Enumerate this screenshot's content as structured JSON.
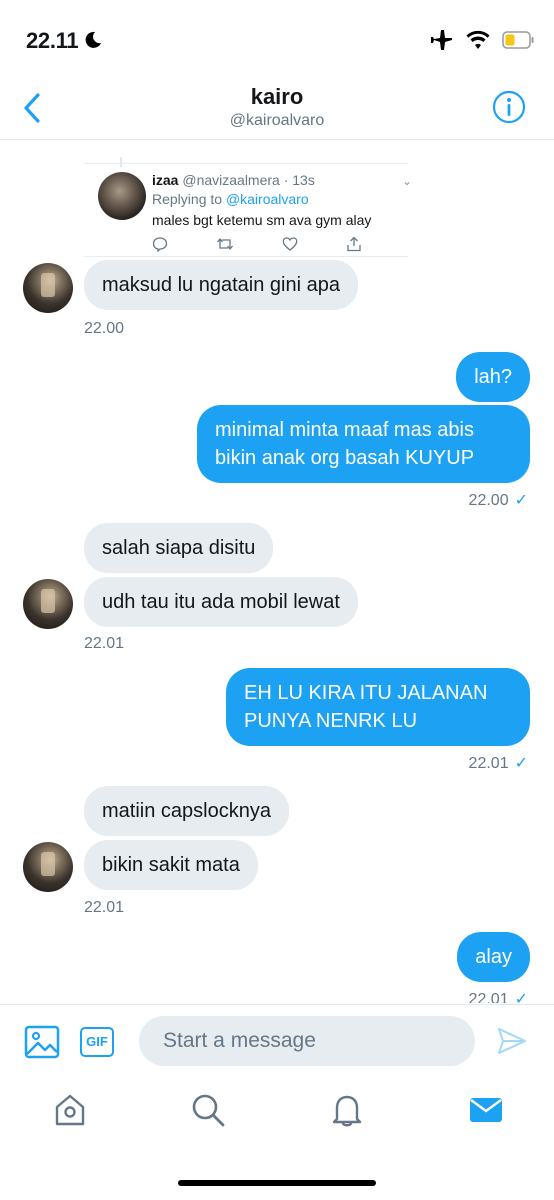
{
  "status_bar": {
    "time": "22.11"
  },
  "header": {
    "title": "kairo",
    "handle": "@kairoalvaro"
  },
  "quoted_tweet": {
    "name": "izaa",
    "meta": "@navizaalmera · 13s",
    "replying_label": "Replying to ",
    "replying_to": "@kairoalvaro",
    "text": "males bgt ketemu sm ava gym alay"
  },
  "messages": [
    {
      "id": "m1",
      "direction": "in",
      "text": "maksud lu ngatain gini apa"
    },
    {
      "id": "t1",
      "stamp": "22.00"
    },
    {
      "id": "m2",
      "direction": "out",
      "text": "lah?"
    },
    {
      "id": "m3",
      "direction": "out",
      "text": "minimal minta maaf mas abis bikin anak org basah KUYUP"
    },
    {
      "id": "t2",
      "stamp": "22.00",
      "check": "✓"
    },
    {
      "id": "m4",
      "direction": "in",
      "text": "salah siapa disitu"
    },
    {
      "id": "m5",
      "direction": "in",
      "text": "udh tau itu ada mobil lewat"
    },
    {
      "id": "t3",
      "stamp": "22.01"
    },
    {
      "id": "m6",
      "direction": "out",
      "text": "EH LU KIRA ITU JALANAN PUNYA NENRK LU"
    },
    {
      "id": "t4",
      "stamp": "22.01",
      "check": "✓"
    },
    {
      "id": "m7",
      "direction": "in",
      "text": "matiin capslocknya"
    },
    {
      "id": "m8",
      "direction": "in",
      "text": "bikin sakit mata"
    },
    {
      "id": "t5",
      "stamp": "22.01"
    },
    {
      "id": "m9",
      "direction": "out",
      "text": "alay"
    },
    {
      "id": "t6",
      "stamp": "22.01",
      "check": "✓"
    }
  ],
  "composer": {
    "placeholder": "Start a message",
    "gif_label": "GIF"
  },
  "colors": {
    "accent": "#1da1f2",
    "incoming_bubble": "#e6ecf0",
    "muted_text": "#657786"
  },
  "tabs": [
    "home-icon",
    "search-icon",
    "notifications-icon",
    "messages-icon"
  ]
}
